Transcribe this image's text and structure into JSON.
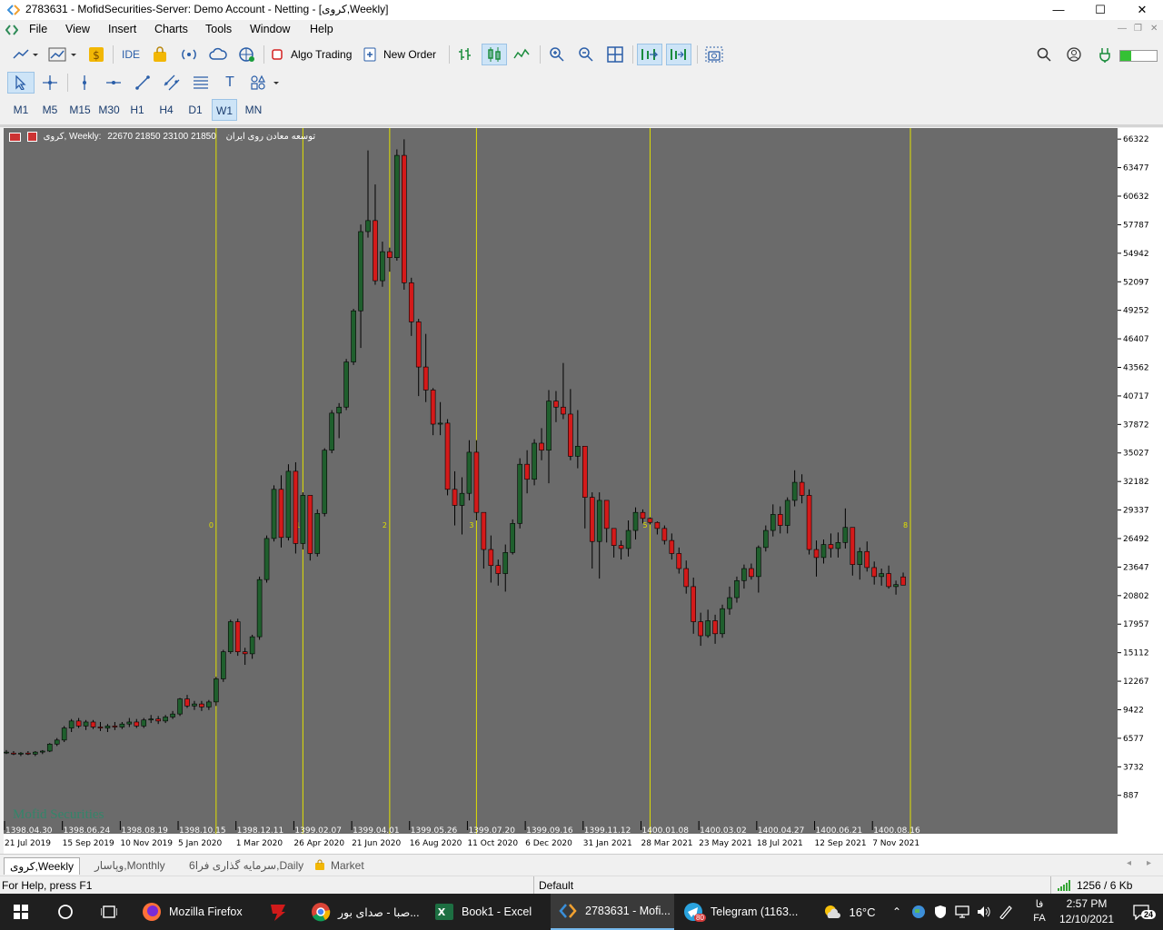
{
  "window": {
    "title": "2783631 - MofidSecurities-Server: Demo Account - Netting - [کروی,Weekly]",
    "minimize": "—",
    "maximize": "☐",
    "close": "✕"
  },
  "menu": {
    "items": [
      "File",
      "View",
      "Insert",
      "Charts",
      "Tools",
      "Window",
      "Help"
    ]
  },
  "toolbar": {
    "ide_label": "IDE",
    "algo_label": "Algo Trading",
    "order_label": "New Order"
  },
  "timeframes": {
    "items": [
      "M1",
      "M5",
      "M15",
      "M30",
      "H1",
      "H4",
      "D1",
      "W1",
      "MN"
    ],
    "selected": "W1"
  },
  "chart_info": {
    "symbol_text": "کروی, Weekly:",
    "ohlc_text": "22670 21850 23100 21850",
    "description": "توسعه معادن روی ایران"
  },
  "watermark": "Mofid Securities",
  "chart_data": {
    "type": "candlestick",
    "price_axis_ticks": [
      "66322",
      "63477",
      "60632",
      "57787",
      "54942",
      "52097",
      "49252",
      "46407",
      "43562",
      "40717",
      "37872",
      "35027",
      "32182",
      "29337",
      "26492",
      "23647",
      "20802",
      "17957",
      "15112",
      "12267",
      "9422",
      "6577",
      "3732",
      "887"
    ],
    "ylim": [
      500,
      66700
    ],
    "time_labels_top": [
      "1398.04.30",
      "1398.06.24",
      "1398.08.19",
      "1398.10.15",
      "1398.12.11",
      "1399.02.07",
      "1399.04.01",
      "1399.05.26",
      "1399.07.20",
      "1399.09.16",
      "1399.11.12",
      "1400.01.08",
      "1400.03.02",
      "1400.04.27",
      "1400.06.21",
      "1400.08.16"
    ],
    "time_labels_bottom": [
      "21 Jul 2019",
      "15 Sep 2019",
      "10 Nov 2019",
      "5 Jan 2020",
      "1 Mar 2020",
      "26 Apr 2020",
      "21 Jun 2020",
      "16 Aug 2020",
      "11 Oct 2020",
      "6 Dec 2020",
      "31 Jan 2021",
      "28 Mar 2021",
      "23 May 2021",
      "18 Jul 2021",
      "12 Sep 2021",
      "7 Nov 2021"
    ],
    "cycle_lines": [
      "0",
      "1",
      "2",
      "3",
      "5",
      "8"
    ],
    "candles_ohlc": [
      [
        5200,
        5400,
        5000,
        5200
      ],
      [
        5100,
        5300,
        4900,
        5000
      ],
      [
        5000,
        5200,
        4800,
        5100
      ],
      [
        5100,
        5300,
        4900,
        5000
      ],
      [
        5000,
        5300,
        4800,
        5200
      ],
      [
        5200,
        5400,
        5000,
        5300
      ],
      [
        5300,
        6100,
        5200,
        6000
      ],
      [
        6000,
        6600,
        5800,
        6400
      ],
      [
        6400,
        7800,
        6200,
        7600
      ],
      [
        7600,
        8500,
        7200,
        8300
      ],
      [
        8300,
        8600,
        7600,
        7800
      ],
      [
        7800,
        8400,
        7400,
        8200
      ],
      [
        8200,
        8400,
        7500,
        7700
      ],
      [
        7700,
        8200,
        7300,
        7600
      ],
      [
        7600,
        8000,
        7200,
        7800
      ],
      [
        7800,
        8200,
        7400,
        7700
      ],
      [
        7700,
        8200,
        7500,
        8000
      ],
      [
        8000,
        8600,
        7700,
        8200
      ],
      [
        8200,
        8500,
        7600,
        7800
      ],
      [
        7800,
        8600,
        7600,
        8400
      ],
      [
        8400,
        8900,
        8100,
        8500
      ],
      [
        8500,
        8800,
        8000,
        8300
      ],
      [
        8300,
        8900,
        8100,
        8700
      ],
      [
        8700,
        9300,
        8500,
        9000
      ],
      [
        9000,
        10600,
        8800,
        10500
      ],
      [
        10500,
        10900,
        9600,
        9800
      ],
      [
        9800,
        10300,
        9400,
        10000
      ],
      [
        10000,
        10300,
        9300,
        9700
      ],
      [
        9700,
        10400,
        9400,
        10200
      ],
      [
        10200,
        12700,
        9800,
        12500
      ],
      [
        12500,
        15400,
        12200,
        15200
      ],
      [
        15200,
        18400,
        15000,
        18200
      ],
      [
        18200,
        18500,
        14800,
        15200
      ],
      [
        15200,
        15600,
        13900,
        15000
      ],
      [
        15000,
        16900,
        14500,
        16700
      ],
      [
        16700,
        22700,
        16400,
        22400
      ],
      [
        22400,
        26800,
        22100,
        26500
      ],
      [
        26500,
        31800,
        26200,
        31400
      ],
      [
        31400,
        32800,
        25600,
        26600
      ],
      [
        26600,
        33900,
        26300,
        33200
      ],
      [
        33200,
        34100,
        25000,
        26000
      ],
      [
        26000,
        31100,
        25400,
        30800
      ],
      [
        30800,
        29000,
        24300,
        25000
      ],
      [
        25000,
        29400,
        24700,
        29000
      ],
      [
        29000,
        35500,
        28700,
        35300
      ],
      [
        35300,
        39300,
        35000,
        39000
      ],
      [
        39000,
        40000,
        36500,
        39600
      ],
      [
        39600,
        44400,
        39300,
        44100
      ],
      [
        44100,
        49400,
        43800,
        49200
      ],
      [
        49200,
        57800,
        45500,
        57100
      ],
      [
        57100,
        65200,
        56500,
        58200
      ],
      [
        58200,
        61800,
        51800,
        52200
      ],
      [
        52200,
        56100,
        51600,
        55100
      ],
      [
        55100,
        55500,
        53100,
        54500
      ],
      [
        54500,
        65300,
        54200,
        64700
      ],
      [
        64700,
        66300,
        51300,
        52000
      ],
      [
        52000,
        52500,
        46700,
        48100
      ],
      [
        48100,
        48400,
        40700,
        43600
      ],
      [
        43600,
        46900,
        40100,
        41300
      ],
      [
        41300,
        41500,
        36800,
        37900
      ],
      [
        37900,
        40100,
        36800,
        38000
      ],
      [
        38000,
        38400,
        30800,
        31400
      ],
      [
        31400,
        33200,
        27800,
        29800
      ],
      [
        29800,
        32600,
        26900,
        31000
      ],
      [
        31000,
        36300,
        30300,
        35100
      ],
      [
        35100,
        36300,
        28300,
        29100
      ],
      [
        29100,
        27400,
        23500,
        25400
      ],
      [
        25400,
        26800,
        22100,
        23800
      ],
      [
        23800,
        24400,
        21800,
        23000
      ],
      [
        23000,
        25900,
        21200,
        25100
      ],
      [
        25100,
        28400,
        24900,
        28000
      ],
      [
        28000,
        34500,
        27500,
        33900
      ],
      [
        33900,
        35300,
        31000,
        32400
      ],
      [
        32400,
        36400,
        31800,
        36000
      ],
      [
        36000,
        37500,
        34300,
        35300
      ],
      [
        35300,
        41300,
        32000,
        40200
      ],
      [
        40200,
        41200,
        38100,
        39600
      ],
      [
        39600,
        44000,
        38400,
        38900
      ],
      [
        38900,
        41400,
        34300,
        34700
      ],
      [
        34700,
        39300,
        33500,
        35700
      ],
      [
        35700,
        35400,
        27500,
        30600
      ],
      [
        30600,
        31100,
        23500,
        26200
      ],
      [
        26200,
        31100,
        22500,
        30300
      ],
      [
        30300,
        28600,
        26100,
        27500
      ],
      [
        27500,
        26700,
        24600,
        25800
      ],
      [
        25800,
        26300,
        24400,
        25500
      ],
      [
        25500,
        28300,
        24700,
        27300
      ],
      [
        27300,
        29600,
        26400,
        29100
      ],
      [
        29100,
        29400,
        28000,
        28500
      ],
      [
        28500,
        28600,
        27900,
        28100
      ],
      [
        28100,
        28200,
        26900,
        27500
      ],
      [
        27500,
        27800,
        25900,
        26300
      ],
      [
        26300,
        27000,
        24400,
        25000
      ],
      [
        25000,
        25600,
        23000,
        23500
      ],
      [
        23500,
        24300,
        21000,
        21700
      ],
      [
        21700,
        22600,
        17000,
        18200
      ],
      [
        18200,
        19100,
        15800,
        16800
      ],
      [
        16800,
        19400,
        16600,
        18300
      ],
      [
        18300,
        18900,
        16000,
        17000
      ],
      [
        17000,
        19900,
        16600,
        19500
      ],
      [
        19500,
        21700,
        18900,
        20600
      ],
      [
        20600,
        22700,
        20100,
        22300
      ],
      [
        22300,
        23900,
        21500,
        23500
      ],
      [
        23500,
        24000,
        22400,
        22700
      ],
      [
        22700,
        25800,
        21100,
        25600
      ],
      [
        25600,
        27800,
        25200,
        27300
      ],
      [
        27300,
        29900,
        26700,
        28900
      ],
      [
        28900,
        29700,
        27000,
        27800
      ],
      [
        27800,
        30600,
        27000,
        30300
      ],
      [
        30300,
        33300,
        29700,
        32100
      ],
      [
        32100,
        32900,
        30000,
        30800
      ],
      [
        30800,
        31400,
        24900,
        25400
      ],
      [
        25400,
        26300,
        22700,
        24600
      ],
      [
        24600,
        26400,
        24000,
        25900
      ],
      [
        25900,
        27000,
        24600,
        25500
      ],
      [
        25500,
        27100,
        24600,
        26100
      ],
      [
        26100,
        29500,
        25500,
        27600
      ],
      [
        27600,
        26900,
        22800,
        23900
      ],
      [
        23900,
        25600,
        22400,
        25200
      ],
      [
        25200,
        26200,
        23200,
        23600
      ],
      [
        23600,
        24200,
        21900,
        22700
      ],
      [
        22700,
        23500,
        21800,
        23000
      ],
      [
        23000,
        23800,
        21500,
        21700
      ],
      [
        21700,
        22300,
        20900,
        21900
      ],
      [
        22670,
        23100,
        21850,
        21850
      ]
    ]
  },
  "tabs": {
    "items": [
      "کروی,Weekly",
      "وپاسار,Monthly",
      "سرمایه گذاری فرا6,Daily",
      "Market"
    ]
  },
  "status": {
    "help": "For Help, press F1",
    "profile": "Default",
    "traffic": "1256 / 6 Kb"
  },
  "taskbar": {
    "tasks": [
      "Mozilla Firefox",
      "صبا - صدای بور...",
      "Book1 - Excel",
      "2783631 - Mofi...",
      "Telegram (1163..."
    ],
    "telegram_badge": "80",
    "weather": "16°C",
    "lang_fa": "فا",
    "lang_code": "FA",
    "time": "2:57 PM",
    "date": "12/10/2021",
    "notifications": "24"
  },
  "colors": {
    "bull": "#1f5f2d",
    "bear": "#d41a1a",
    "chart_bg": "#6b6b6b",
    "cycle_line": "#e0e000"
  }
}
